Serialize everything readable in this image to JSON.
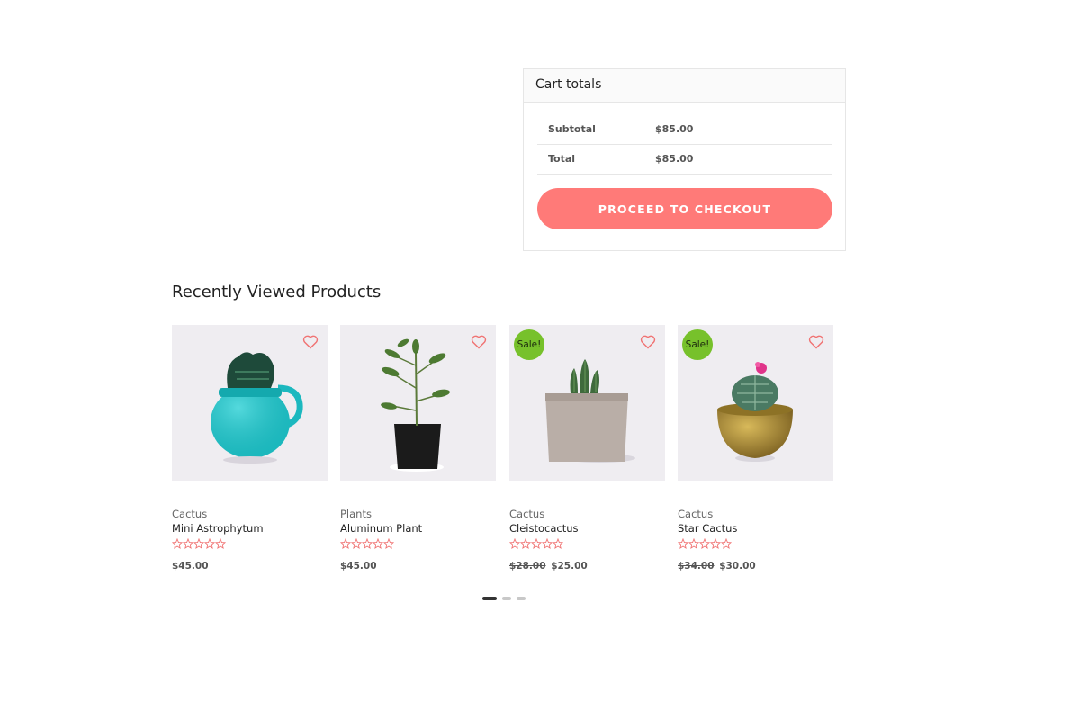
{
  "cart_totals": {
    "title": "Cart totals",
    "rows": [
      {
        "label": "Subtotal",
        "value": "$85.00"
      },
      {
        "label": "Total",
        "value": "$85.00"
      }
    ],
    "checkout_label": "PROCEED TO CHECKOUT",
    "accent": "#ff7a78"
  },
  "recently_viewed": {
    "title": "Recently Viewed Products",
    "products": [
      {
        "category": "Cactus",
        "name": "Mini Astrophytum",
        "old_price": "",
        "price": "$45.00",
        "sale": false,
        "sale_label": ""
      },
      {
        "category": "Plants",
        "name": "Aluminum Plant",
        "old_price": "",
        "price": "$45.00",
        "sale": false,
        "sale_label": ""
      },
      {
        "category": "Cactus",
        "name": "Cleistocactus",
        "old_price": "$28.00",
        "price": "$25.00",
        "sale": true,
        "sale_label": "Sale!"
      },
      {
        "category": "Cactus",
        "name": "Star Cactus",
        "old_price": "$34.00",
        "price": "$30.00",
        "sale": true,
        "sale_label": "Sale!"
      }
    ],
    "sale_color": "#77c12b",
    "carousel_pages": 3,
    "carousel_active": 0
  }
}
